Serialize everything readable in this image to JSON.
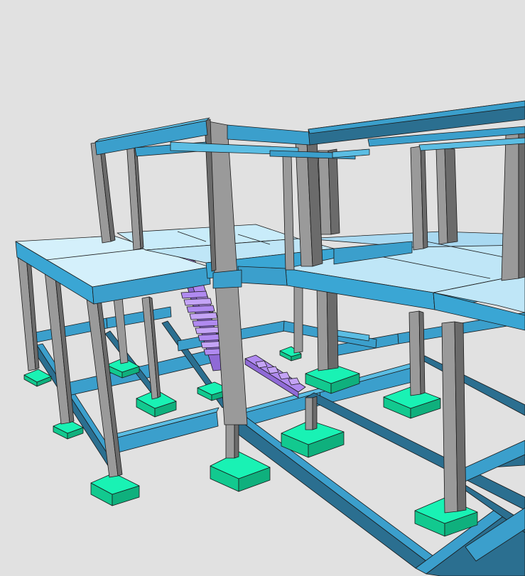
{
  "view": {
    "kind": "3d-structural-model",
    "background": "#e1e1e1"
  },
  "colors": {
    "slab_top": "#bfe6f7",
    "slab_top_light": "#d4f0fb",
    "slab_edge": "#3aa6d4",
    "beam_side": "#3b9fcc",
    "beam_top": "#5bbde3",
    "beam_dark": "#2b6f90",
    "column_light": "#9a9a9a",
    "column_dark": "#6b6b6b",
    "footing_top": "#19f2b4",
    "footing_side": "#12c98f",
    "stair": "#b08af0",
    "stair_dark": "#8f6ad6",
    "outline": "#1a1a1a"
  },
  "elements": {
    "slabs": "slab",
    "beams": "beam",
    "columns": "column",
    "footings": "footing",
    "stairs": "stair"
  }
}
